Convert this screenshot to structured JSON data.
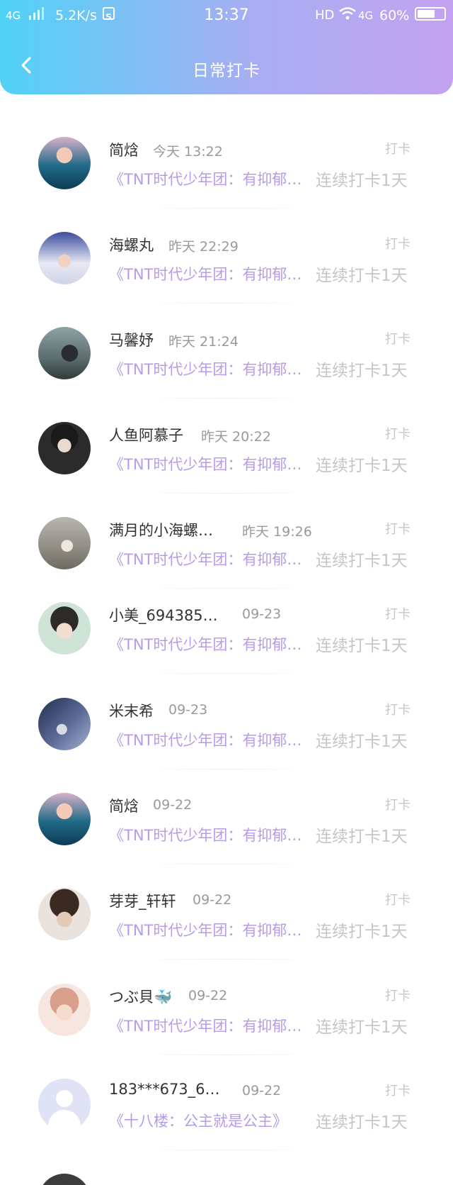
{
  "status_bar": {
    "network_left": "4G",
    "speed": "5.2K/s",
    "s_badge": "S",
    "time": "13:37",
    "hd": "HD",
    "network_right": "4G",
    "battery": "60%"
  },
  "header": {
    "back_icon": "chevron-left-icon",
    "title": "日常打卡",
    "gradient": [
      "#4fd2f6",
      "#a7aef2",
      "#c3a2f0"
    ]
  },
  "colors": {
    "book_title": "#b79ce6",
    "streak": "#c6c6c6",
    "name": "#333333",
    "time": "#9a9a9a"
  },
  "checkins": [
    {
      "name": "简焓",
      "time": "今天 13:22",
      "tag": "打卡",
      "book": "《TNT时代少年团：有抑郁…",
      "streak": "连续打卡1天"
    },
    {
      "name": "海螺丸",
      "time": "昨天 22:29",
      "tag": "打卡",
      "book": "《TNT时代少年团：有抑郁…",
      "streak": "连续打卡1天"
    },
    {
      "name": "马馨妤",
      "time": "昨天 21:24",
      "tag": "打卡",
      "book": "《TNT时代少年团：有抑郁…",
      "streak": "连续打卡1天"
    },
    {
      "name": "人鱼阿慕子",
      "time": "昨天 20:22",
      "tag": "打卡",
      "book": "《TNT时代少年团：有抑郁…",
      "streak": "连续打卡1天"
    },
    {
      "name": "满月的小海螺…",
      "time": "昨天 19:26",
      "tag": "打卡",
      "book": "《TNT时代少年团：有抑郁…",
      "streak": "连续打卡1天"
    },
    {
      "name": "小美_694385…",
      "time": "09-23",
      "tag": "打卡",
      "book": "《TNT时代少年团：有抑郁…",
      "streak": "连续打卡1天"
    },
    {
      "name": "米末希",
      "time": "09-23",
      "tag": "打卡",
      "book": "《TNT时代少年团：有抑郁…",
      "streak": "连续打卡1天"
    },
    {
      "name": "简焓",
      "time": "09-22",
      "tag": "打卡",
      "book": "《TNT时代少年团：有抑郁…",
      "streak": "连续打卡1天"
    },
    {
      "name": "芽芽_轩轩",
      "time": "09-22",
      "tag": "打卡",
      "book": "《TNT时代少年团：有抑郁…",
      "streak": "连续打卡1天"
    },
    {
      "name": "つぶ貝🐳",
      "time": "09-22",
      "tag": "打卡",
      "book": "《TNT时代少年团：有抑郁…",
      "streak": "连续打卡1天"
    },
    {
      "name": "183***673_6…",
      "time": "09-22",
      "tag": "打卡",
      "book": "《十八楼：公主就是公主》",
      "streak": "连续打卡1天"
    }
  ]
}
